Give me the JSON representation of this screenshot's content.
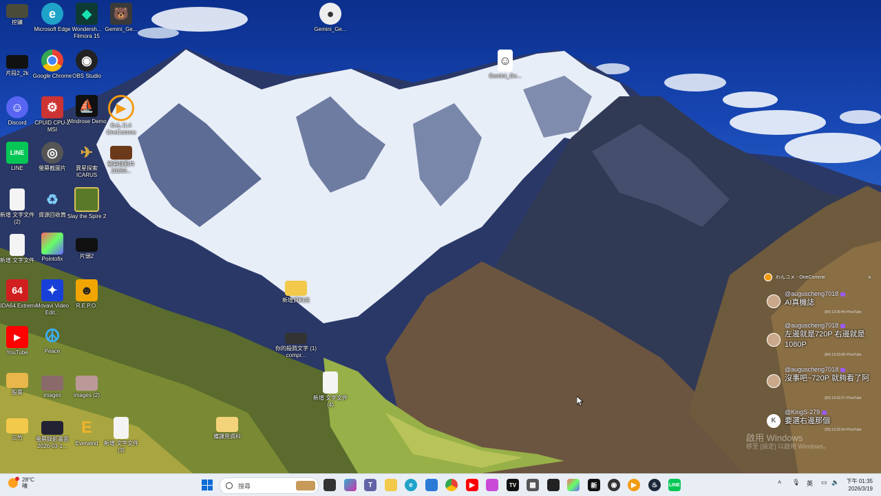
{
  "desktop": {
    "icons": [
      {
        "label": "挖礦"
      },
      {
        "label": "Microsoft Edge"
      },
      {
        "label": "Wondersh... Filmora 15"
      },
      {
        "label": "Gemini_Ge..."
      },
      {
        "label": "Gemini_Ge..."
      },
      {
        "label": "片段2_2k"
      },
      {
        "label": "Google Chrome"
      },
      {
        "label": "OBS Studio"
      },
      {
        "label": "Gemini_Ge..."
      },
      {
        "label": "Discord"
      },
      {
        "label": "CPUID CPU-Z MSI"
      },
      {
        "label": "Windrose Demo"
      },
      {
        "label": "わんコメ OneComme"
      },
      {
        "label": "LINE"
      },
      {
        "label": "螢幕截圖片"
      },
      {
        "label": "異星探索 ICARUS"
      },
      {
        "label": "螢幕錄影片 20260..."
      },
      {
        "label": "新增 文字文件 (2)"
      },
      {
        "label": "資源回收筒"
      },
      {
        "label": "Slay the Spire 2"
      },
      {
        "label": "新增 文字文件"
      },
      {
        "label": "Pointofix"
      },
      {
        "label": "片頭2"
      },
      {
        "label": "AIDA64 Extreme"
      },
      {
        "label": "Movavi Video Edit..."
      },
      {
        "label": "R.E.P.O."
      },
      {
        "label": "新增資料夾"
      },
      {
        "label": "YouTube"
      },
      {
        "label": "Peace"
      },
      {
        "label": "你的殺戮文字 (1) compr..."
      },
      {
        "label": "股票"
      },
      {
        "label": "images"
      },
      {
        "label": "images (2)"
      },
      {
        "label": "新增 文字文件 (4)"
      },
      {
        "label": "三竹"
      },
      {
        "label": "螢幕錄影畫面 2026-03-1..."
      },
      {
        "label": "Everwind"
      },
      {
        "label": "新增 文字文件 (3)"
      },
      {
        "label": "備課用資料"
      }
    ]
  },
  "chat": {
    "title": "わんコメ - OneComme",
    "close": "×",
    "messages": [
      {
        "user": "@auguscheng7018",
        "text": "AI真機誌",
        "meta": "(85) 13:35:44 #YouTube"
      },
      {
        "user": "@auguscheng7018",
        "text": "左邊就是720P 右邊就是1080P",
        "meta": "(84) 13:33:08 #YouTube"
      },
      {
        "user": "@auguscheng7018",
        "text": "沒事吧~720P 就夠看了阿",
        "meta": "(83) 13:32:27 #YouTube"
      },
      {
        "user": "@KingS-279",
        "text": "要選右邊那個",
        "meta": "(35) 13:32:24 #YouTube"
      }
    ],
    "watermark1": "啟用 Windows",
    "watermark2": "移至 [設定] 以啟用 Windows。"
  },
  "taskbar": {
    "weather_temp": "28°C",
    "weather_cond": "晴",
    "search_placeholder": "搜尋",
    "tray_lang": "英",
    "time": "下午 01:35",
    "date": "2026/3/19"
  },
  "colors": {
    "taskbar_bg": "#e9eef5",
    "accent": "#0f6cd6"
  }
}
